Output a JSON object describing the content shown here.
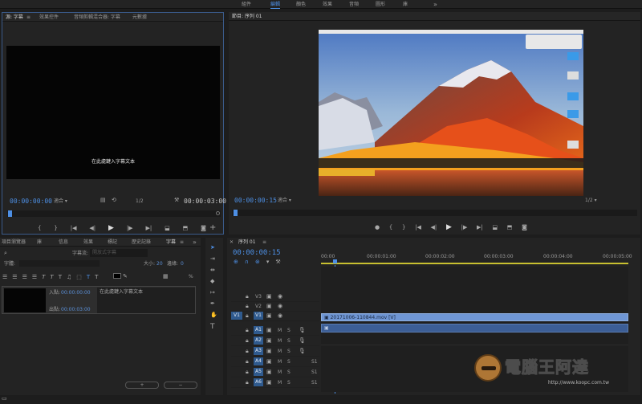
{
  "workspace_tabs": [
    "組件",
    "編輯",
    "顏色",
    "效果",
    "音頻",
    "圖形",
    "庫"
  ],
  "workspace_more": "»",
  "source_panel": {
    "tabs": [
      "源: 字幕",
      "效果控件",
      "音頻剪輯混合器: 字幕",
      "元數據"
    ],
    "menu_icon": "≡",
    "caption_text": "在此處鍵入字幕文本",
    "timecode_in": "00:00:00:00",
    "fit_label": "適合",
    "fraction": "1/2",
    "timecode_duration": "00:00:03:00"
  },
  "program_panel": {
    "title": "節目: 序列 01",
    "timecode": "00:00:00:15",
    "fit_label": "適合",
    "fraction": "1/2"
  },
  "captions_panel": {
    "tabs": [
      "項目瀏覽器",
      "庫",
      "信息",
      "效果",
      "標記",
      "歷史記錄",
      "字幕"
    ],
    "search_label": "字幕流:",
    "search_placeholder": "開放式字幕",
    "font_label": "字體:",
    "size_label": "大小:",
    "size_value": "20",
    "edge_label": "邊緣:",
    "edge_value": "0",
    "in_label": "入點:",
    "in_value": "00:00:00:00",
    "out_label": "出點:",
    "out_value": "00:00:03:00",
    "caption_entry_text": "在此處鍵入字幕文本",
    "add_btn": "+",
    "remove_btn": "−"
  },
  "timeline": {
    "title": "序列 01",
    "timecode": "00:00:00:15",
    "ruler_labels": [
      "00:00",
      "00:00:01:00",
      "00:00:02:00",
      "00:00:03:00",
      "00:00:04:00",
      "00:00:05:00"
    ],
    "tracks_video": [
      "V3",
      "V2",
      "V1"
    ],
    "tracks_audio": [
      "A1",
      "A2",
      "A3",
      "A4",
      "A5",
      "A6"
    ],
    "clip_name": "20171006-110844.mov [V]",
    "source_patch": "V1"
  },
  "watermark": {
    "title": "電腦王阿達",
    "url": "http://www.koopc.com.tw"
  },
  "colors": {
    "accent": "#4d8fe4",
    "clip": "#6a8fc8",
    "panel": "#232323"
  }
}
